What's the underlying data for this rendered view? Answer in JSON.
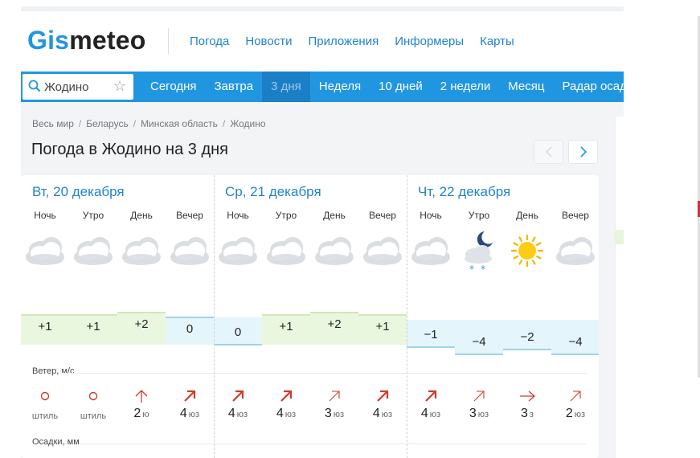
{
  "logo": {
    "part1": "Gis",
    "part2": "meteo"
  },
  "topnav": [
    "Погода",
    "Новости",
    "Приложения",
    "Информеры",
    "Карты"
  ],
  "search": {
    "city": "Жодино",
    "icon": "search-icon",
    "fav_icon": "star-icon"
  },
  "tabs": [
    "Сегодня",
    "Завтра",
    "3 дня",
    "Неделя",
    "10 дней",
    "2 недели",
    "Месяц",
    "Радар осадков"
  ],
  "active_tab": "3 дня",
  "breadcrumb": [
    "Весь мир",
    "Беларусь",
    "Минская область",
    "Жодино"
  ],
  "page_title": "Погода в Жодино на 3 дня",
  "pager": {
    "prev_icon": "chevron-left-icon",
    "next_icon": "chevron-right-icon"
  },
  "labels": {
    "wind": "Ветер, м/с",
    "precip": "Осадки, мм"
  },
  "days": [
    {
      "title": "Вт, 20 декабря",
      "periods": [
        {
          "name": "Ночь",
          "icon": "cloud-icon",
          "temp": "+1",
          "temp_level": 1,
          "wind_speed": "",
          "wind_dir": "штиль",
          "wind_icon": "calm-icon"
        },
        {
          "name": "Утро",
          "icon": "cloud-icon",
          "temp": "+1",
          "temp_level": 1,
          "wind_speed": "",
          "wind_dir": "штиль",
          "wind_icon": "calm-icon"
        },
        {
          "name": "День",
          "icon": "cloud-icon",
          "temp": "+2",
          "temp_level": 2,
          "wind_speed": "2",
          "wind_dir": "ю",
          "wind_icon": "arrow-up-icon"
        },
        {
          "name": "Вечер",
          "icon": "cloud-icon",
          "temp": "0",
          "temp_level": 0,
          "wind_speed": "4",
          "wind_dir": "юз",
          "wind_icon": "arrow-ne-icon"
        }
      ]
    },
    {
      "title": "Ср, 21 декабря",
      "periods": [
        {
          "name": "Ночь",
          "icon": "cloud-icon",
          "temp": "0",
          "temp_level": 0,
          "wind_speed": "4",
          "wind_dir": "юз",
          "wind_icon": "arrow-ne-icon"
        },
        {
          "name": "Утро",
          "icon": "cloud-icon",
          "temp": "+1",
          "temp_level": 1,
          "wind_speed": "4",
          "wind_dir": "юз",
          "wind_icon": "arrow-ne-icon"
        },
        {
          "name": "День",
          "icon": "cloud-icon",
          "temp": "+2",
          "temp_level": 2,
          "wind_speed": "3",
          "wind_dir": "юз",
          "wind_icon": "arrow-ne-light-icon"
        },
        {
          "name": "Вечер",
          "icon": "cloud-icon",
          "temp": "+1",
          "temp_level": 1,
          "wind_speed": "4",
          "wind_dir": "юз",
          "wind_icon": "arrow-ne-icon"
        }
      ]
    },
    {
      "title": "Чт, 22 декабря",
      "periods": [
        {
          "name": "Ночь",
          "icon": "cloud-icon",
          "temp": "−1",
          "temp_level": -1,
          "wind_speed": "4",
          "wind_dir": "юз",
          "wind_icon": "arrow-ne-icon"
        },
        {
          "name": "Утро",
          "icon": "moon-cloud-snow-icon",
          "temp": "−4",
          "temp_level": -4,
          "wind_speed": "3",
          "wind_dir": "юз",
          "wind_icon": "arrow-ne-light-icon"
        },
        {
          "name": "День",
          "icon": "sun-icon",
          "temp": "−2",
          "temp_level": -2,
          "wind_speed": "3",
          "wind_dir": "з",
          "wind_icon": "arrow-right-icon"
        },
        {
          "name": "Вечер",
          "icon": "cloud-icon",
          "temp": "−4",
          "temp_level": -4,
          "wind_speed": "2",
          "wind_dir": "юз",
          "wind_icon": "arrow-ne-light-icon"
        }
      ]
    }
  ],
  "colors": {
    "brand_blue": "#2196e0",
    "warm_fill": "#eaf7df",
    "warm_line": "#cfe8b8",
    "cold_fill": "#e4f5fb",
    "cold_line": "#9fd3ea",
    "wind_arrow": "#d23a2a"
  }
}
